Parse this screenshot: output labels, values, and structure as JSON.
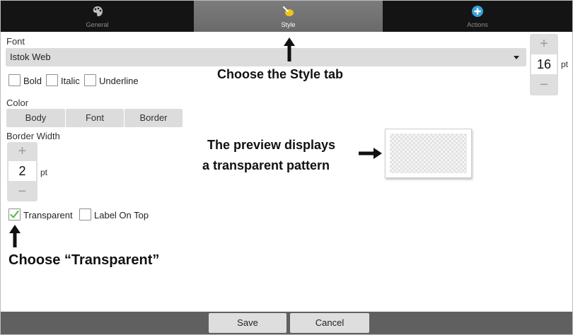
{
  "tabs": [
    {
      "label": "General",
      "icon": "palette-icon",
      "active": false
    },
    {
      "label": "Style",
      "icon": "style-brush-icon",
      "active": true
    },
    {
      "label": "Actions",
      "icon": "add-circle-icon",
      "active": false
    }
  ],
  "font": {
    "label": "Font",
    "value": "Istok Web",
    "size": "16",
    "size_unit": "pt",
    "options": [
      {
        "label": "Bold",
        "checked": false
      },
      {
        "label": "Italic",
        "checked": false
      },
      {
        "label": "Underline",
        "checked": false
      }
    ]
  },
  "color": {
    "label": "Color",
    "buttons": [
      "Body",
      "Font",
      "Border"
    ]
  },
  "border": {
    "label": "Border Width",
    "value": "2",
    "unit": "pt"
  },
  "checks": [
    {
      "label": "Transparent",
      "checked": true
    },
    {
      "label": "Label On Top",
      "checked": false
    }
  ],
  "stepper": {
    "plus": "+",
    "minus": "−"
  },
  "annotations": {
    "style_tab": "Choose the Style tab",
    "preview_line1": "The preview displays",
    "preview_line2": "a transparent pattern",
    "transparent": "Choose “Transparent”"
  },
  "bottom": {
    "save": "Save",
    "cancel": "Cancel"
  },
  "colors": {
    "check_green": "#5dbb46",
    "tab_active": "#727272",
    "tabbar": "#141414",
    "actions_icon": "#3aa0d8"
  }
}
